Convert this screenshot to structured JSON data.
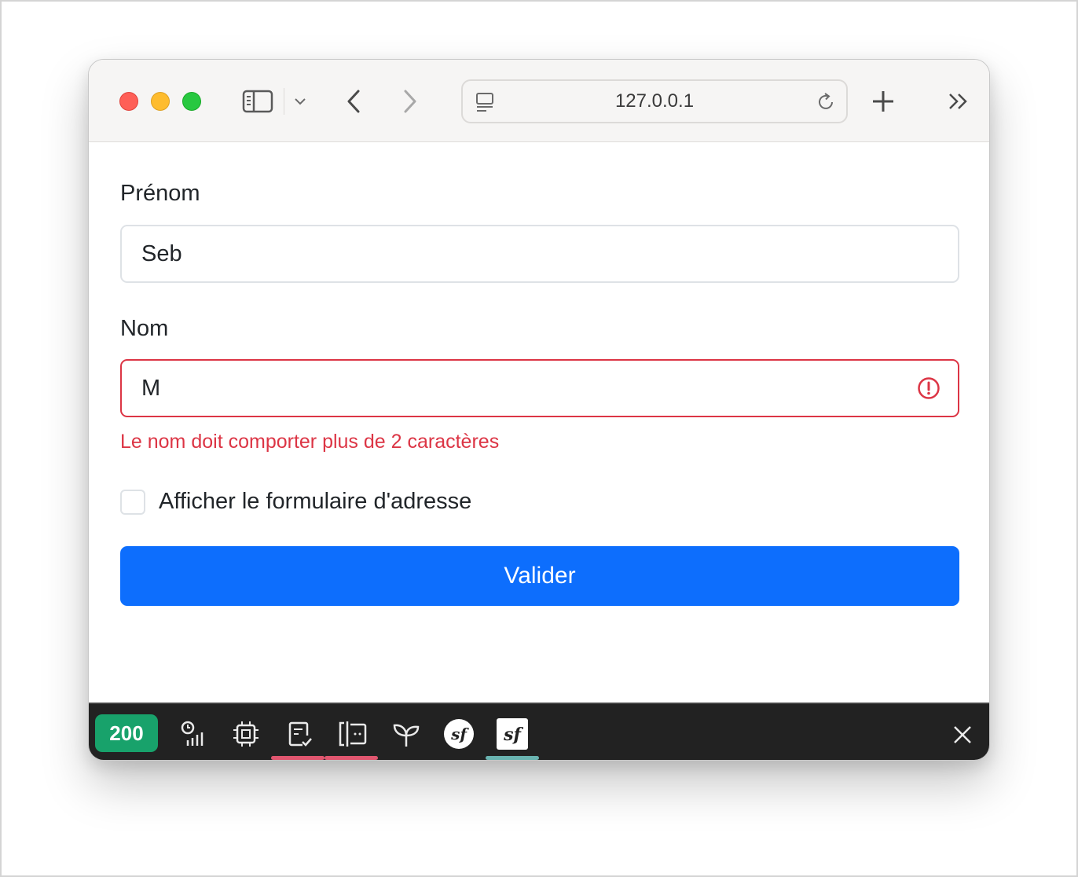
{
  "browser": {
    "url": "127.0.0.1",
    "icons": {
      "sidebar": "sidebar-icon",
      "sidebar_menu": "chevron-down-icon",
      "back": "chevron-left-icon",
      "forward": "chevron-right-icon",
      "page": "page-icon",
      "reload": "reload-icon",
      "new_tab": "plus-icon",
      "more": "double-chevron-right-icon"
    }
  },
  "form": {
    "prenom_label": "Prénom",
    "prenom_value": "Seb",
    "nom_label": "Nom",
    "nom_value": "M",
    "nom_error": "Le nom doit comporter plus de 2 caractères",
    "address_checkbox_label": "Afficher le formulaire d'adresse",
    "address_checkbox_checked": false,
    "submit_label": "Valider"
  },
  "devbar": {
    "status_code": "200",
    "colors": {
      "status": "#18a26b",
      "error_underline": "#e0566f",
      "active_underline": "#69b3b0"
    },
    "panels": [
      {
        "icon": "timing-icon"
      },
      {
        "icon": "memory-icon"
      },
      {
        "icon": "forms-icon",
        "underline": "error"
      },
      {
        "icon": "validator-icon",
        "underline": "error"
      },
      {
        "icon": "twig-icon"
      },
      {
        "icon": "symfony-icon"
      },
      {
        "icon": "symfony-config-icon",
        "underline": "active"
      }
    ],
    "close_icon": "close-icon"
  },
  "colors": {
    "primary": "#0d6efd",
    "danger": "#dc3545"
  }
}
